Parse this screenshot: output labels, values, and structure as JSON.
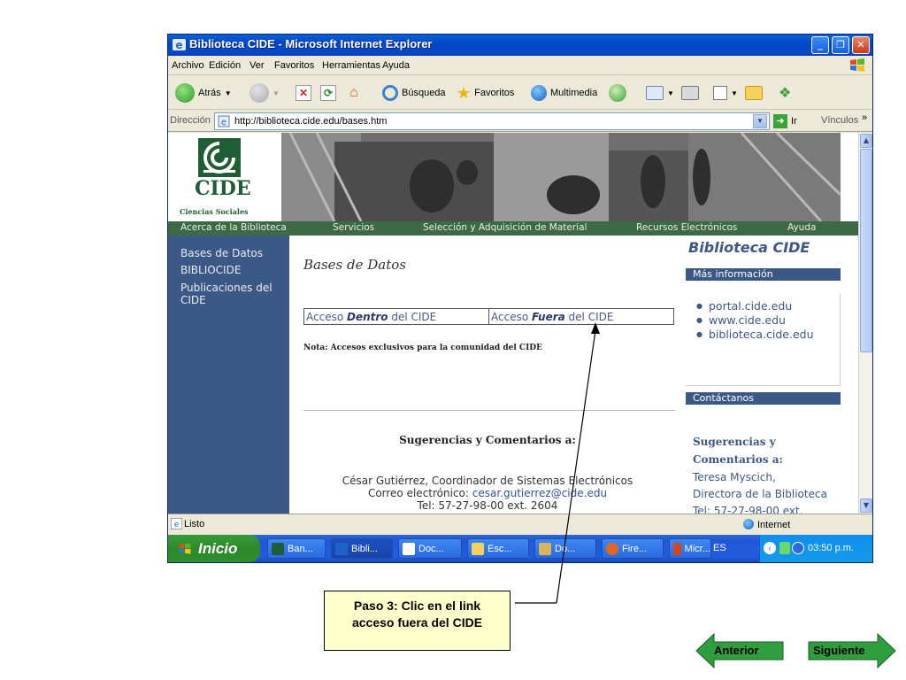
{
  "window": {
    "title": "Biblioteca CIDE - Microsoft Internet Explorer",
    "minimize": "_",
    "maximize": "❐",
    "close": "✕"
  },
  "menu": [
    "Archivo",
    "Edición",
    "Ver",
    "Favoritos",
    "Herramientas",
    "Ayuda"
  ],
  "toolbar": {
    "back": "Atrás",
    "search": "Búsqueda",
    "favorites": "Favoritos",
    "multimedia": "Multimedia"
  },
  "address": {
    "label": "Dirección",
    "url": "http://biblioteca.cide.edu/bases.htm",
    "go": "Ir",
    "links": "Vínculos"
  },
  "site": {
    "logo_text": "CIDE",
    "logo_sub": "Ciencias Sociales",
    "nav": [
      "Acerca de la Biblioteca",
      "Servicios",
      "Selección y Adquisición de Material",
      "Recursos Electrónicos",
      "Ayuda"
    ],
    "sidebar": [
      "Bases de Datos",
      "BIBLIOCIDE",
      "Publicaciones del",
      "CIDE"
    ],
    "page_title": "Bases de Datos",
    "access_dentro_prefix": "Acceso ",
    "access_dentro_bold": "Dentro",
    "access_dentro_suffix": " del CIDE",
    "access_fuera_prefix": "Acceso ",
    "access_fuera_bold": "Fuera",
    "access_fuera_suffix": " del CIDE",
    "note": "Nota: Accesos exclusivos para la comunidad del CIDE",
    "suggestions_heading": "Sugerencias y Comentarios a:",
    "contact_name": "César Gutiérrez, Coordinador de Sistemas Electrónicos",
    "contact_email_label": "Correo electrónico: ",
    "contact_email": "cesar.gutierrez@cide.edu",
    "contact_phone": "Tel: 57-27-98-00 ext. 2604"
  },
  "right": {
    "title": "Biblioteca CIDE",
    "more_info": "Más información",
    "links": [
      "portal.cide.edu",
      "www.cide.edu",
      "biblioteca.cide.edu"
    ],
    "contact": "Contáctanos",
    "sug1": "Sugerencias y",
    "sug2": "Comentarios a:",
    "dir1": "Teresa Myscich,",
    "dir2": "Directora de la Biblioteca",
    "dir3": "Tel: 57-27-98-00 ext."
  },
  "status": {
    "text": "Listo",
    "zone": "Internet"
  },
  "taskbar": {
    "start": "Inicio",
    "tasks": [
      "Ban...",
      "Bibli...",
      "Doc...",
      "Esc...",
      "Do...",
      "Fire...",
      "Micr..."
    ],
    "lang": "ES",
    "clock": "03:50 p.m."
  },
  "annotation": {
    "line1": "Paso 3: Clic en el  link",
    "line2": "acceso fuera del CIDE",
    "prev": "Anterior",
    "next": "Siguiente"
  },
  "colors": {
    "sidebar_blue": "#3c5886",
    "nav_green": "#3d6a44",
    "callout_yellow": "#ffffcc",
    "nav_arrow_green": "#2e9e3e"
  }
}
